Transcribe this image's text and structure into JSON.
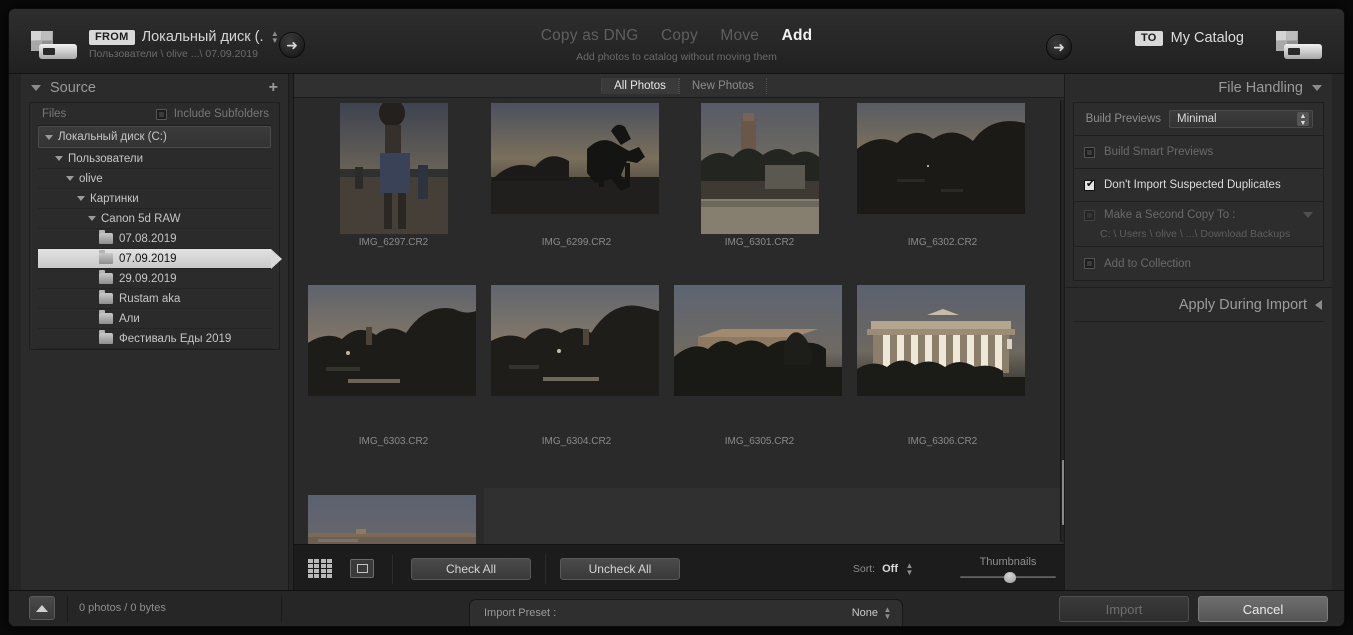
{
  "header": {
    "from_badge": "FROM",
    "source_name": "Локальный диск (...",
    "source_path": "Пользователи \\ olive ...\\ 07.09.2019",
    "to_badge": "TO",
    "catalog": "My Catalog",
    "modes": [
      {
        "label": "Copy as DNG",
        "active": false
      },
      {
        "label": "Copy",
        "active": false
      },
      {
        "label": "Move",
        "active": false
      },
      {
        "label": "Add",
        "active": true
      }
    ],
    "mode_description": "Add photos to catalog without moving them",
    "left_arrow_glyph": "➜",
    "right_arrow_glyph": "➜"
  },
  "source_panel": {
    "title": "Source",
    "add_icon": "+",
    "files_label": "Files",
    "include_subfolders_label": "Include Subfolders",
    "include_subfolders_checked": false,
    "tree": [
      {
        "label": "Локальный диск (C:)",
        "depth": 0,
        "type": "disk",
        "selected": false
      },
      {
        "label": "Пользователи",
        "depth": 1,
        "type": "twisty",
        "selected": false
      },
      {
        "label": "olive",
        "depth": 2,
        "type": "twisty",
        "selected": false
      },
      {
        "label": "Картинки",
        "depth": 3,
        "type": "twisty",
        "selected": false
      },
      {
        "label": "Canon 5d RAW",
        "depth": 4,
        "type": "twisty",
        "selected": false
      },
      {
        "label": "07.08.2019",
        "depth": 5,
        "type": "folder",
        "selected": false
      },
      {
        "label": "07.09.2019",
        "depth": 5,
        "type": "folder",
        "selected": true
      },
      {
        "label": "29.09.2019",
        "depth": 5,
        "type": "folder",
        "selected": false
      },
      {
        "label": "Rustam aka",
        "depth": 5,
        "type": "folder",
        "selected": false
      },
      {
        "label": "Али",
        "depth": 5,
        "type": "folder",
        "selected": false
      },
      {
        "label": "Фестиваль Еды 2019",
        "depth": 5,
        "type": "folder",
        "selected": false
      }
    ]
  },
  "file_handling": {
    "title": "File Handling",
    "build_previews_label": "Build Previews",
    "build_previews_value": "Minimal",
    "build_smart_previews_label": "Build Smart Previews",
    "build_smart_previews_checked": false,
    "dont_import_duplicates_label": "Don't Import Suspected Duplicates",
    "dont_import_duplicates_checked": true,
    "second_copy_label": "Make a Second Copy To :",
    "second_copy_checked": false,
    "second_copy_path": "C: \\ Users \\ olive \\ ...\\ Download Backups",
    "add_to_collection_label": "Add to Collection",
    "add_to_collection_checked": false,
    "apply_during_import_label": "Apply During Import"
  },
  "center": {
    "tabs": [
      {
        "label": "All Photos",
        "active": true
      },
      {
        "label": "New Photos",
        "active": false
      }
    ],
    "photos": [
      {
        "name": "IMG_6297.CR2",
        "orientation": "portrait",
        "scene": "person-statue"
      },
      {
        "name": "IMG_6299.CR2",
        "orientation": "landscape",
        "scene": "horse-statue"
      },
      {
        "name": "IMG_6301.CR2",
        "orientation": "portrait",
        "scene": "tower"
      },
      {
        "name": "IMG_6302.CR2",
        "orientation": "landscape",
        "scene": "dark-trees"
      },
      {
        "name": "IMG_6303.CR2",
        "orientation": "landscape",
        "scene": "dusk-road"
      },
      {
        "name": "IMG_6304.CR2",
        "orientation": "landscape",
        "scene": "dusk-road-2"
      },
      {
        "name": "IMG_6305.CR2",
        "orientation": "landscape",
        "scene": "building"
      },
      {
        "name": "IMG_6306.CR2",
        "orientation": "landscape",
        "scene": "columns-building"
      },
      {
        "name": "",
        "orientation": "landscape",
        "scene": "sunset-partial"
      }
    ]
  },
  "toolbar": {
    "grid_view_icon": "grid-view-icon",
    "loupe_view_icon": "loupe-view-icon",
    "check_all_label": "Check All",
    "uncheck_all_label": "Uncheck All",
    "sort_label": "Sort:",
    "sort_value": "Off",
    "thumbnails_label": "Thumbnails"
  },
  "footer": {
    "collapse_icon": "collapse-up-icon",
    "count_text": "0 photos / 0 bytes",
    "import_preset_label": "Import Preset :",
    "import_preset_value": "None",
    "import_label": "Import",
    "cancel_label": "Cancel"
  },
  "colors": {
    "dialog_bg": "#252525",
    "panel_bg": "#2b2b2b",
    "selection": "#d8d8d8",
    "accent_text": "#f2f2f2"
  }
}
